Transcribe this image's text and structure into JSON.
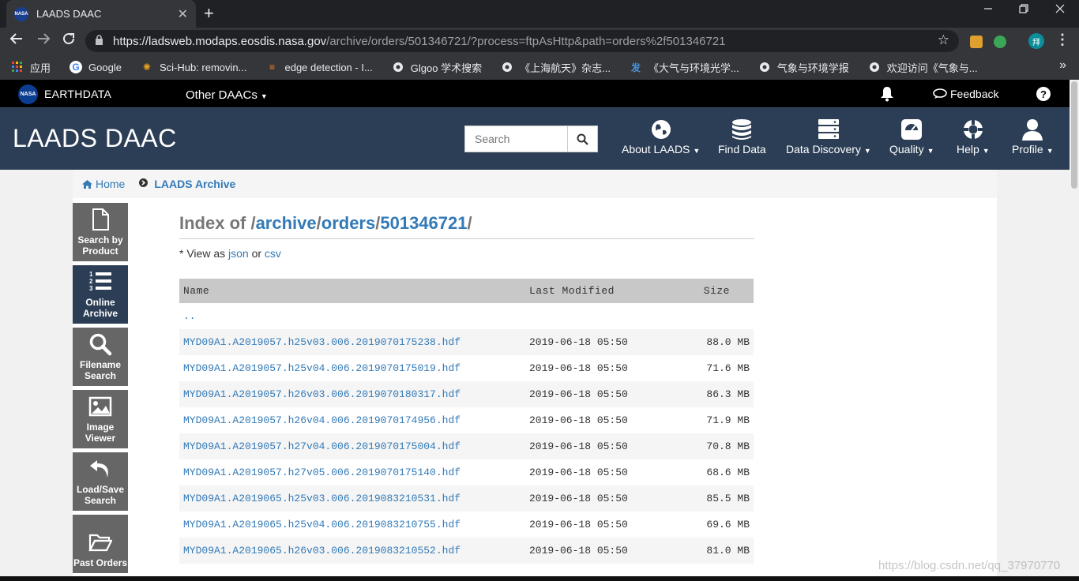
{
  "browser": {
    "tab_title": "LAADS DAAC",
    "tab_favicon": "NASA",
    "close_glyph": "✕",
    "new_tab_glyph": "+",
    "url_host": "https://ladsweb.modaps.eosdis.nasa.gov",
    "url_path": "/archive/orders/501346721/?process=ftpAsHttp&path=orders%2f501346721",
    "profile_initial": "拜",
    "bookmarks": [
      {
        "label": "应用",
        "icon": "apps-grid-icon"
      },
      {
        "label": "Google",
        "icon": "google-icon"
      },
      {
        "label": "Sci-Hub: removin...",
        "icon": "scihub-icon"
      },
      {
        "label": "edge detection - I...",
        "icon": "stackoverflow-icon"
      },
      {
        "label": "Glgoo 学术搜索",
        "icon": "globe-icon"
      },
      {
        "label": "《上海航天》杂志...",
        "icon": "globe-icon"
      },
      {
        "label": "《大气与环境光学...",
        "icon": "fa-icon"
      },
      {
        "label": "气象与环境学报",
        "icon": "globe-icon"
      },
      {
        "label": "欢迎访问《气象与...",
        "icon": "globe-icon"
      }
    ]
  },
  "earthdata": {
    "logo_text": "NASA",
    "brand": "EARTHDATA",
    "other_daacs": "Other DAACs",
    "feedback": "Feedback",
    "help": "?"
  },
  "header": {
    "title": "LAADS DAAC",
    "search_placeholder": "Search",
    "nav": [
      {
        "label": "About LAADS",
        "icon": "globe-icon",
        "caret": true
      },
      {
        "label": "Find Data",
        "icon": "database-icon",
        "caret": false
      },
      {
        "label": "Data Discovery",
        "icon": "server-icon",
        "caret": true
      },
      {
        "label": "Quality",
        "icon": "gauge-icon",
        "caret": true
      },
      {
        "label": "Help",
        "icon": "lifebuoy-icon",
        "caret": true
      },
      {
        "label": "Profile",
        "icon": "user-icon",
        "caret": true
      }
    ]
  },
  "breadcrumb": {
    "home": "Home",
    "current": "LAADS Archive"
  },
  "sidebar": [
    {
      "label": "Search by\nProduct",
      "icon": "file-icon",
      "active": false
    },
    {
      "label": "Online\nArchive",
      "icon": "numbered-list-icon",
      "active": true
    },
    {
      "label": "Filename\nSearch",
      "icon": "search-icon",
      "active": false
    },
    {
      "label": "Image\nViewer",
      "icon": "image-icon",
      "active": false
    },
    {
      "label": "Load/Save\nSearch",
      "icon": "undo-icon",
      "active": false
    },
    {
      "label": "Past Orders",
      "icon": "folder-open-icon",
      "active": false
    }
  ],
  "index": {
    "prefix": "Index of /",
    "seg1": "archive",
    "seg2": "orders",
    "seg3": "501346721",
    "viewas_prefix": "* View as ",
    "json": "json",
    "or": " or ",
    "csv": "csv",
    "headers": {
      "name": "Name",
      "modified": "Last Modified",
      "size": "Size"
    },
    "parent": "..",
    "files": [
      {
        "name": "MYD09A1.A2019057.h25v03.006.2019070175238.hdf",
        "modified": "2019-06-18 05:50",
        "size": "88.0 MB"
      },
      {
        "name": "MYD09A1.A2019057.h25v04.006.2019070175019.hdf",
        "modified": "2019-06-18 05:50",
        "size": "71.6 MB"
      },
      {
        "name": "MYD09A1.A2019057.h26v03.006.2019070180317.hdf",
        "modified": "2019-06-18 05:50",
        "size": "86.3 MB"
      },
      {
        "name": "MYD09A1.A2019057.h26v04.006.2019070174956.hdf",
        "modified": "2019-06-18 05:50",
        "size": "71.9 MB"
      },
      {
        "name": "MYD09A1.A2019057.h27v04.006.2019070175004.hdf",
        "modified": "2019-06-18 05:50",
        "size": "70.8 MB"
      },
      {
        "name": "MYD09A1.A2019057.h27v05.006.2019070175140.hdf",
        "modified": "2019-06-18 05:50",
        "size": "68.6 MB"
      },
      {
        "name": "MYD09A1.A2019065.h25v03.006.2019083210531.hdf",
        "modified": "2019-06-18 05:50",
        "size": "85.5 MB"
      },
      {
        "name": "MYD09A1.A2019065.h25v04.006.2019083210755.hdf",
        "modified": "2019-06-18 05:50",
        "size": "69.6 MB"
      },
      {
        "name": "MYD09A1.A2019065.h26v03.006.2019083210552.hdf",
        "modified": "2019-06-18 05:50",
        "size": "81.0 MB"
      }
    ]
  },
  "watermark": "https://blog.csdn.net/qq_37970770"
}
